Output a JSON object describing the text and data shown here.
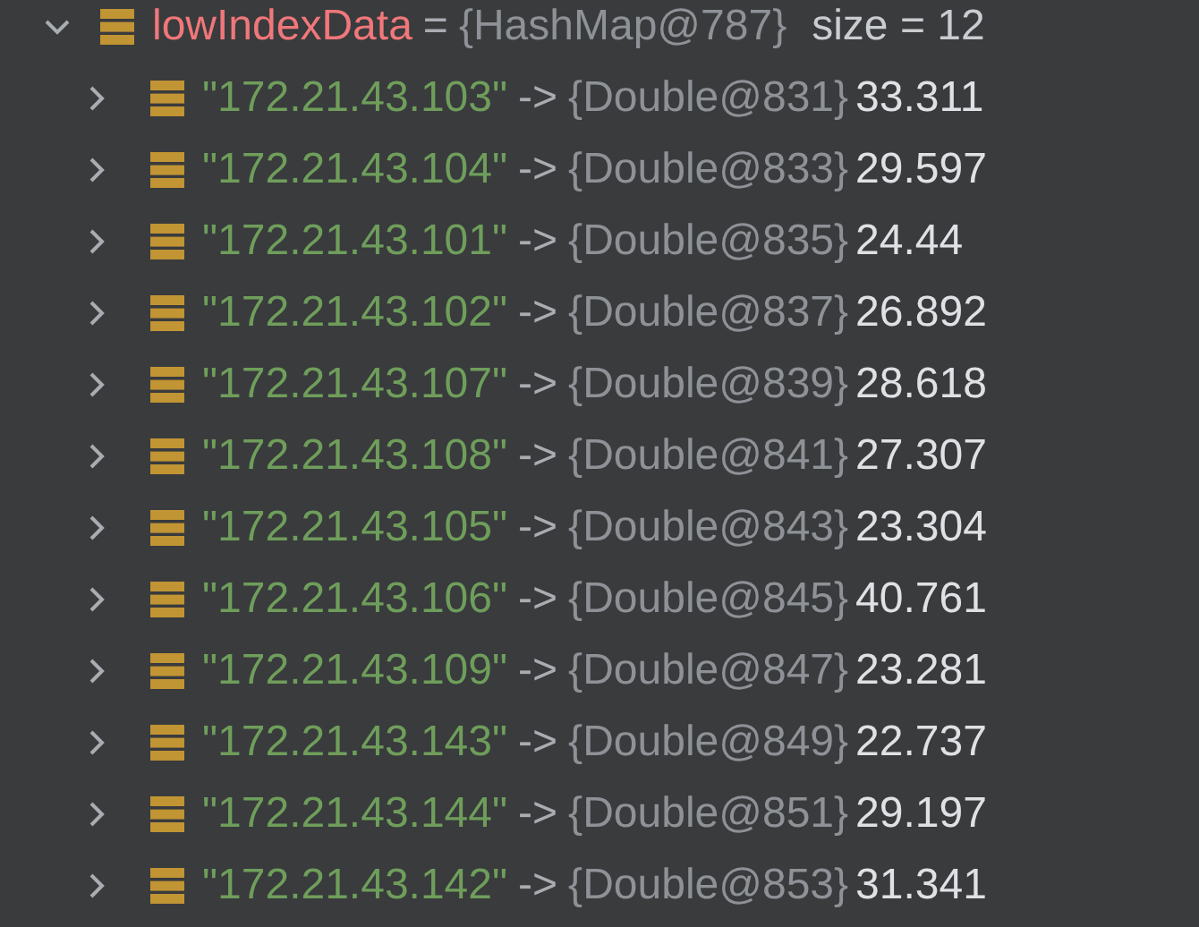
{
  "variable": {
    "name": "lowIndexData",
    "equals": "=",
    "type": "{HashMap@787}",
    "size": "size = 12",
    "expanded": true,
    "children": [
      {
        "key": "\"172.21.43.103\"",
        "arrow": "->",
        "ref": "{Double@831}",
        "value": "33.311",
        "expanded": false
      },
      {
        "key": "\"172.21.43.104\"",
        "arrow": "->",
        "ref": "{Double@833}",
        "value": "29.597",
        "expanded": false
      },
      {
        "key": "\"172.21.43.101\"",
        "arrow": "->",
        "ref": "{Double@835}",
        "value": "24.44",
        "expanded": false
      },
      {
        "key": "\"172.21.43.102\"",
        "arrow": "->",
        "ref": "{Double@837}",
        "value": "26.892",
        "expanded": false
      },
      {
        "key": "\"172.21.43.107\"",
        "arrow": "->",
        "ref": "{Double@839}",
        "value": "28.618",
        "expanded": false
      },
      {
        "key": "\"172.21.43.108\"",
        "arrow": "->",
        "ref": "{Double@841}",
        "value": "27.307",
        "expanded": false
      },
      {
        "key": "\"172.21.43.105\"",
        "arrow": "->",
        "ref": "{Double@843}",
        "value": "23.304",
        "expanded": false
      },
      {
        "key": "\"172.21.43.106\"",
        "arrow": "->",
        "ref": "{Double@845}",
        "value": "40.761",
        "expanded": false
      },
      {
        "key": "\"172.21.43.109\"",
        "arrow": "->",
        "ref": "{Double@847}",
        "value": "23.281",
        "expanded": false
      },
      {
        "key": "\"172.21.43.143\"",
        "arrow": "->",
        "ref": "{Double@849}",
        "value": "22.737",
        "expanded": false
      },
      {
        "key": "\"172.21.43.144\"",
        "arrow": "->",
        "ref": "{Double@851}",
        "value": "29.197",
        "expanded": false
      },
      {
        "key": "\"172.21.43.142\"",
        "arrow": "->",
        "ref": "{Double@853}",
        "value": "31.341",
        "expanded": false
      }
    ]
  }
}
